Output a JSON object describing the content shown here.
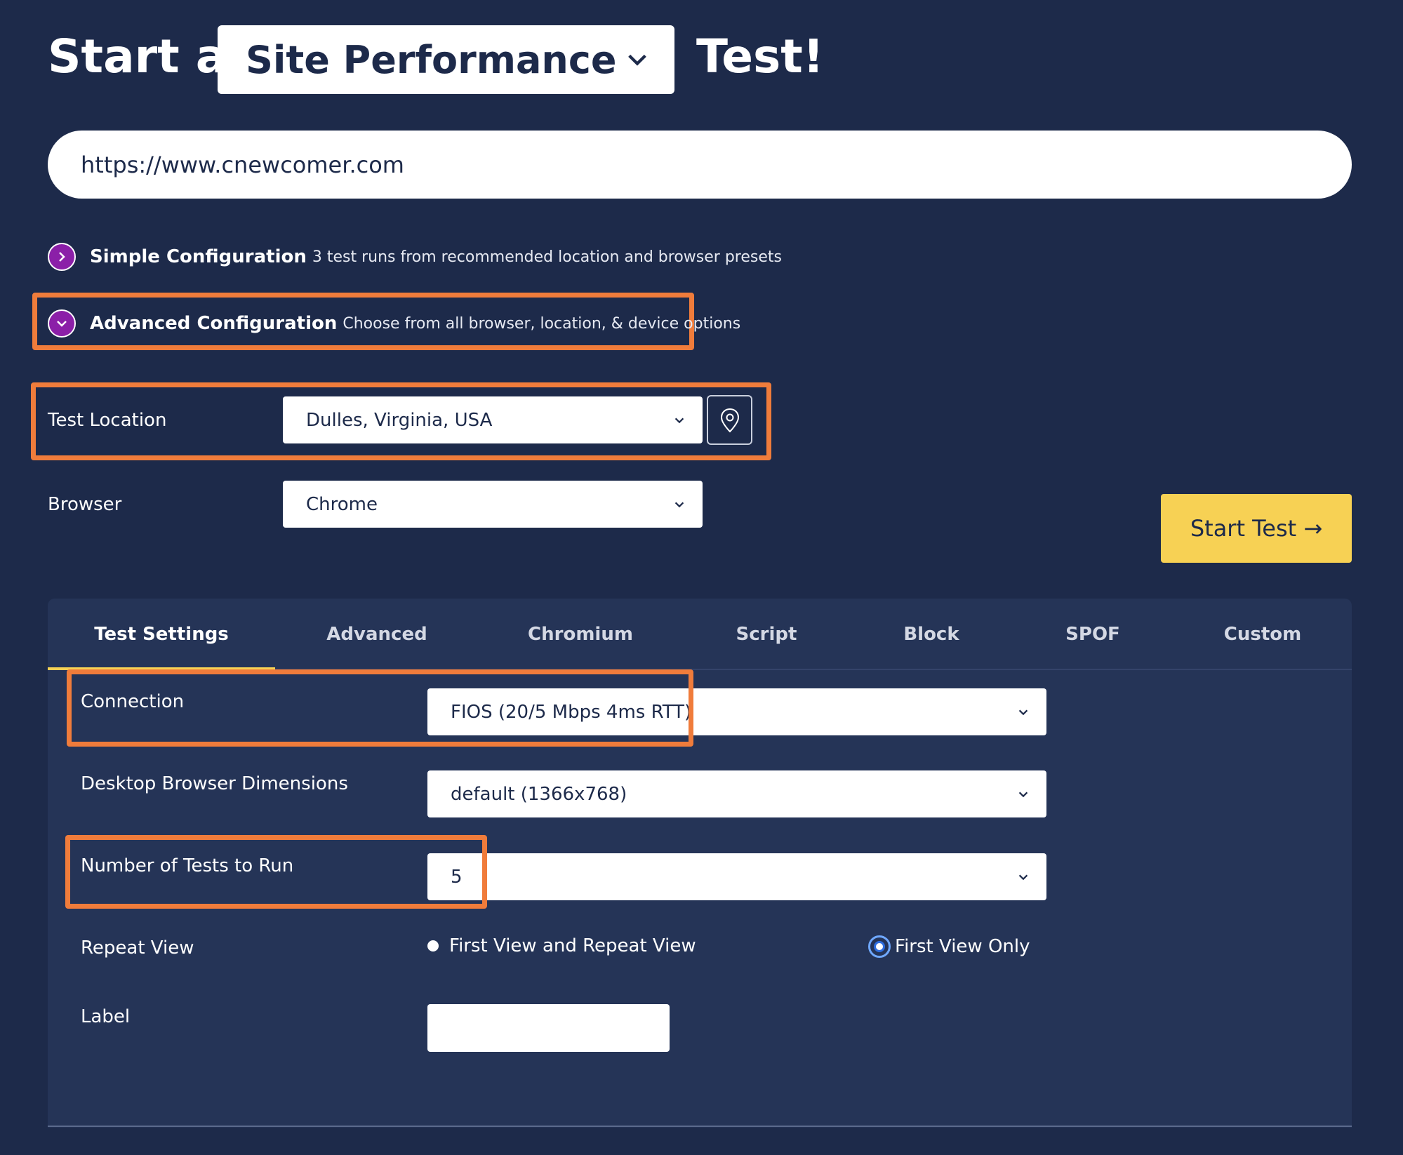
{
  "header": {
    "prefix": "Start a",
    "test_type": "Site Performance",
    "suffix": "Test!"
  },
  "url": {
    "value": "https://www.cnewcomer.com"
  },
  "simple_config": {
    "title": "Simple Configuration",
    "description": "3 test runs from recommended location and browser presets"
  },
  "advanced_config": {
    "title": "Advanced Configuration",
    "description": "Choose from all browser, location, & device options"
  },
  "test_location": {
    "label": "Test Location",
    "value": "Dulles, Virginia, USA"
  },
  "browser": {
    "label": "Browser",
    "value": "Chrome"
  },
  "start_button": {
    "label": "Start Test →"
  },
  "tabs": [
    {
      "label": "Test Settings"
    },
    {
      "label": "Advanced"
    },
    {
      "label": "Chromium"
    },
    {
      "label": "Script"
    },
    {
      "label": "Block"
    },
    {
      "label": "SPOF"
    },
    {
      "label": "Custom"
    }
  ],
  "settings": {
    "connection": {
      "label": "Connection",
      "value": "FIOS (20/5 Mbps 4ms RTT)"
    },
    "dimensions": {
      "label": "Desktop Browser Dimensions",
      "value": "default (1366x768)"
    },
    "num_tests": {
      "label": "Number of Tests to Run",
      "value": "5"
    },
    "repeat_view": {
      "label": "Repeat View",
      "option_1": "First View and Repeat View",
      "option_2": "First View Only"
    },
    "label_field": {
      "label": "Label",
      "value": ""
    }
  },
  "colors": {
    "background": "#1d2a4a",
    "panel": "#253457",
    "highlight": "#f07c3b",
    "start_button": "#f7d154",
    "config_icon": "#8b1fa8"
  },
  "icons": {
    "dropdown": "chevron-down-icon",
    "location": "map-pin-icon",
    "simple": "chevron-right-icon",
    "advanced": "chevron-down-icon"
  }
}
